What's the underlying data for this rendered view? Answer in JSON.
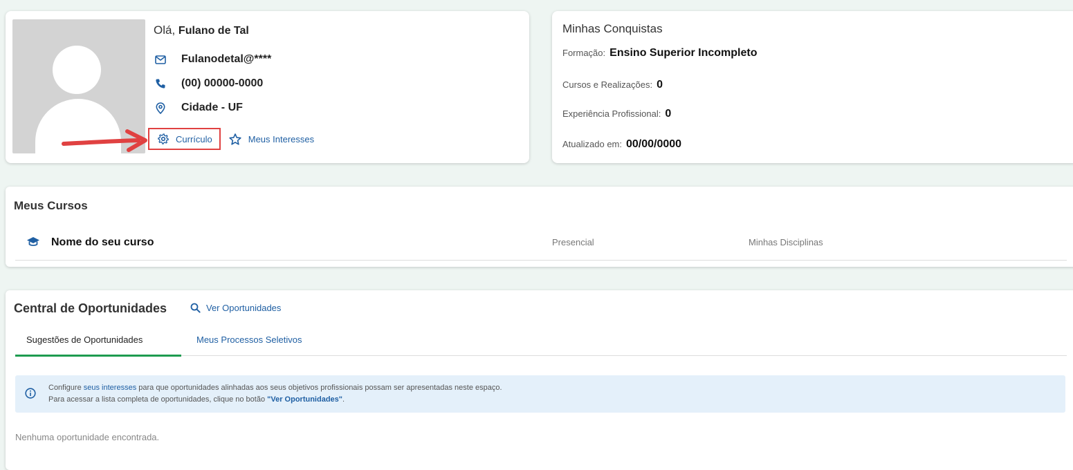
{
  "profile": {
    "greeting": "Olá,",
    "name": "Fulano de Tal",
    "email": "Fulanodetal@****",
    "phone": "(00) 00000-0000",
    "location": "Cidade - UF",
    "curriculo_label": "Currículo",
    "interesses_label": "Meus Interesses"
  },
  "achievements": {
    "title": "Minhas Conquistas",
    "formacao_label": "Formação:",
    "formacao_value": "Ensino Superior Incompleto",
    "cursos_label": "Cursos e Realizações:",
    "cursos_value": "0",
    "experiencia_label": "Experiência Profissional:",
    "experiencia_value": "0",
    "atualizado_label": "Atualizado em:",
    "atualizado_value": "00/00/0000"
  },
  "courses": {
    "title": "Meus Cursos",
    "items": [
      {
        "name": "Nome do seu curso",
        "mode": "Presencial",
        "disciplinas": "Minhas Disciplinas"
      }
    ]
  },
  "opportunities": {
    "title": "Central de Oportunidades",
    "ver_label": "Ver Oportunidades",
    "tabs": [
      {
        "label": "Sugestões de Oportunidades"
      },
      {
        "label": "Meus Processos Seletivos"
      }
    ],
    "alert": {
      "line1_prefix": "Configure",
      "line1_link": "seus interesses",
      "line1_suffix": "para que oportunidades alinhadas aos seus objetivos profissionais possam ser apresentadas neste espaço.",
      "line2_prefix": "Para acessar a lista completa de oportunidades, clique no botão",
      "line2_link": "\"Ver Oportunidades\"",
      "line2_suffix": "."
    },
    "empty_text": "Nenhuma oportunidade encontrada."
  },
  "colors": {
    "link": "#1f5fa3",
    "tab_active_underline": "#1d9b4f",
    "highlight_box": "#e04141",
    "alert_bg": "#e4f0fa"
  },
  "icons": [
    "mail-icon",
    "phone-icon",
    "location-pin-icon",
    "gear-icon",
    "star-icon",
    "graduation-cap-icon",
    "search-icon",
    "info-icon",
    "red-arrow-annotation"
  ]
}
